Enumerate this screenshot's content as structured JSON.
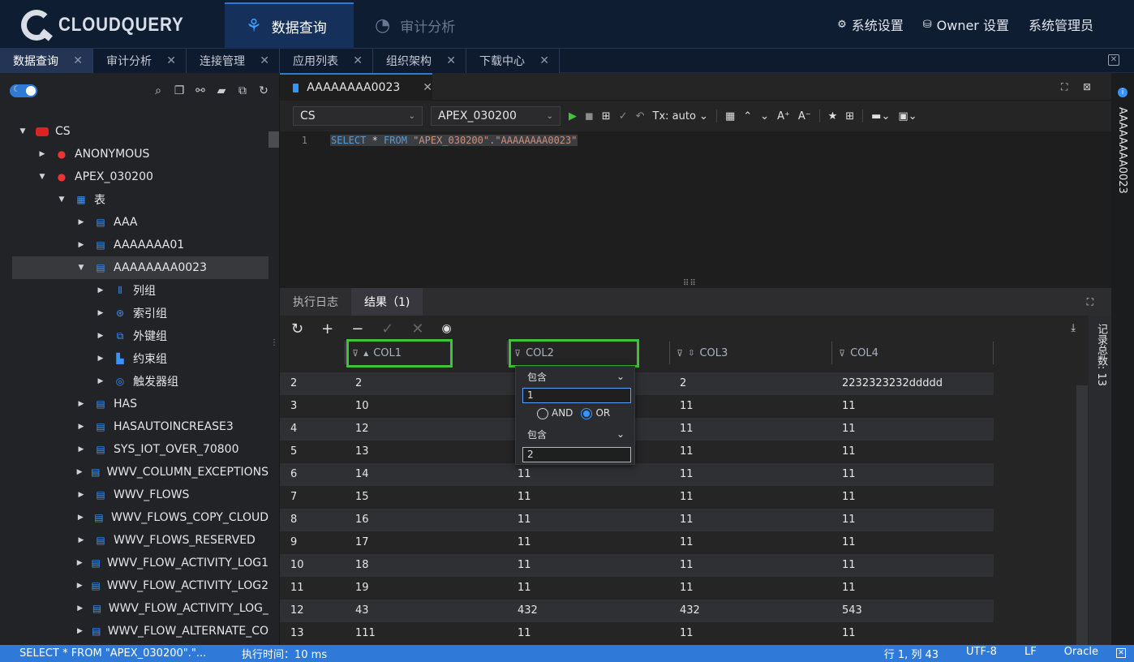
{
  "app": {
    "logo_text": "CLOUDQUERY"
  },
  "nav": {
    "tabs": [
      {
        "label": "数据查询",
        "active": true
      },
      {
        "label": "审计分析",
        "active": false
      }
    ],
    "right": {
      "settings": "系统设置",
      "owner": "Owner 设置",
      "admin": "系统管理员"
    }
  },
  "feature_tabs": [
    "数据查询",
    "审计分析",
    "连接管理",
    "应用列表",
    "组织架构",
    "下载中心"
  ],
  "tree": {
    "root": "CS",
    "schemas": [
      "ANONYMOUS",
      "APEX_030200"
    ],
    "tables_group": "表",
    "tables_before": [
      "AAA",
      "AAAAAAA01"
    ],
    "selected_table": "AAAAAAAA0023",
    "table_children": [
      "列组",
      "索引组",
      "外键组",
      "约束组",
      "触发器组"
    ],
    "tables_after": [
      "HAS",
      "HASAUTOINCREASE3",
      "SYS_IOT_OVER_70800",
      "WWV_COLUMN_EXCEPTIONS",
      "WWV_FLOWS",
      "WWV_FLOWS_COPY_CLOUD",
      "WWV_FLOWS_RESERVED",
      "WWV_FLOW_ACTIVITY_LOG1",
      "WWV_FLOW_ACTIVITY_LOG2",
      "WWV_FLOW_ACTIVITY_LOG_",
      "WWV_FLOW_ALTERNATE_CO"
    ]
  },
  "editor": {
    "tab_title": "AAAAAAAA0023",
    "connection": "CS",
    "schema": "APEX_030200",
    "tx_mode": "Tx: auto",
    "line_number": "1",
    "sql": {
      "kw1": "SELECT",
      "star": " * ",
      "kw2": "FROM",
      "target": " \"APEX_030200\".\"AAAAAAAA0023\""
    }
  },
  "results": {
    "tabs": [
      "执行日志",
      "结果（1)"
    ],
    "columns": [
      "COL1",
      "COL2",
      "COL3",
      "COL4"
    ],
    "rows": [
      [
        "2",
        "2",
        "",
        "2",
        "2232323232ddddd"
      ],
      [
        "3",
        "10",
        "",
        "11",
        "11"
      ],
      [
        "4",
        "12",
        "",
        "11",
        "11"
      ],
      [
        "5",
        "13",
        "",
        "11",
        "11"
      ],
      [
        "6",
        "14",
        "11",
        "11",
        "11"
      ],
      [
        "7",
        "15",
        "11",
        "11",
        "11"
      ],
      [
        "8",
        "16",
        "11",
        "11",
        "11"
      ],
      [
        "9",
        "17",
        "11",
        "11",
        "11"
      ],
      [
        "10",
        "18",
        "11",
        "11",
        "11"
      ],
      [
        "11",
        "19",
        "11",
        "11",
        "11"
      ],
      [
        "12",
        "43",
        "432",
        "432",
        "543"
      ],
      [
        "13",
        "111",
        "11",
        "11",
        "11"
      ]
    ],
    "record_count": "记录总数: 13"
  },
  "filter_popup": {
    "op1": "包含",
    "value1": "1",
    "and_label": "AND",
    "or_label": "OR",
    "logic_selected": "OR",
    "op2": "包含",
    "value2": "2"
  },
  "right_panel_title": "AAAAAAAA0023",
  "status": {
    "sql_preview": "SELECT * FROM \"APEX_030200\".\"...",
    "exec_time": "执行时间：10 ms",
    "position": "行 1, 列 43",
    "encoding": "UTF-8",
    "eol": "LF",
    "db": "Oracle"
  },
  "colors": {
    "accent": "#2f7ad8",
    "highlight_box": "#3ec33a",
    "nav_bg": "#0f1d33"
  }
}
